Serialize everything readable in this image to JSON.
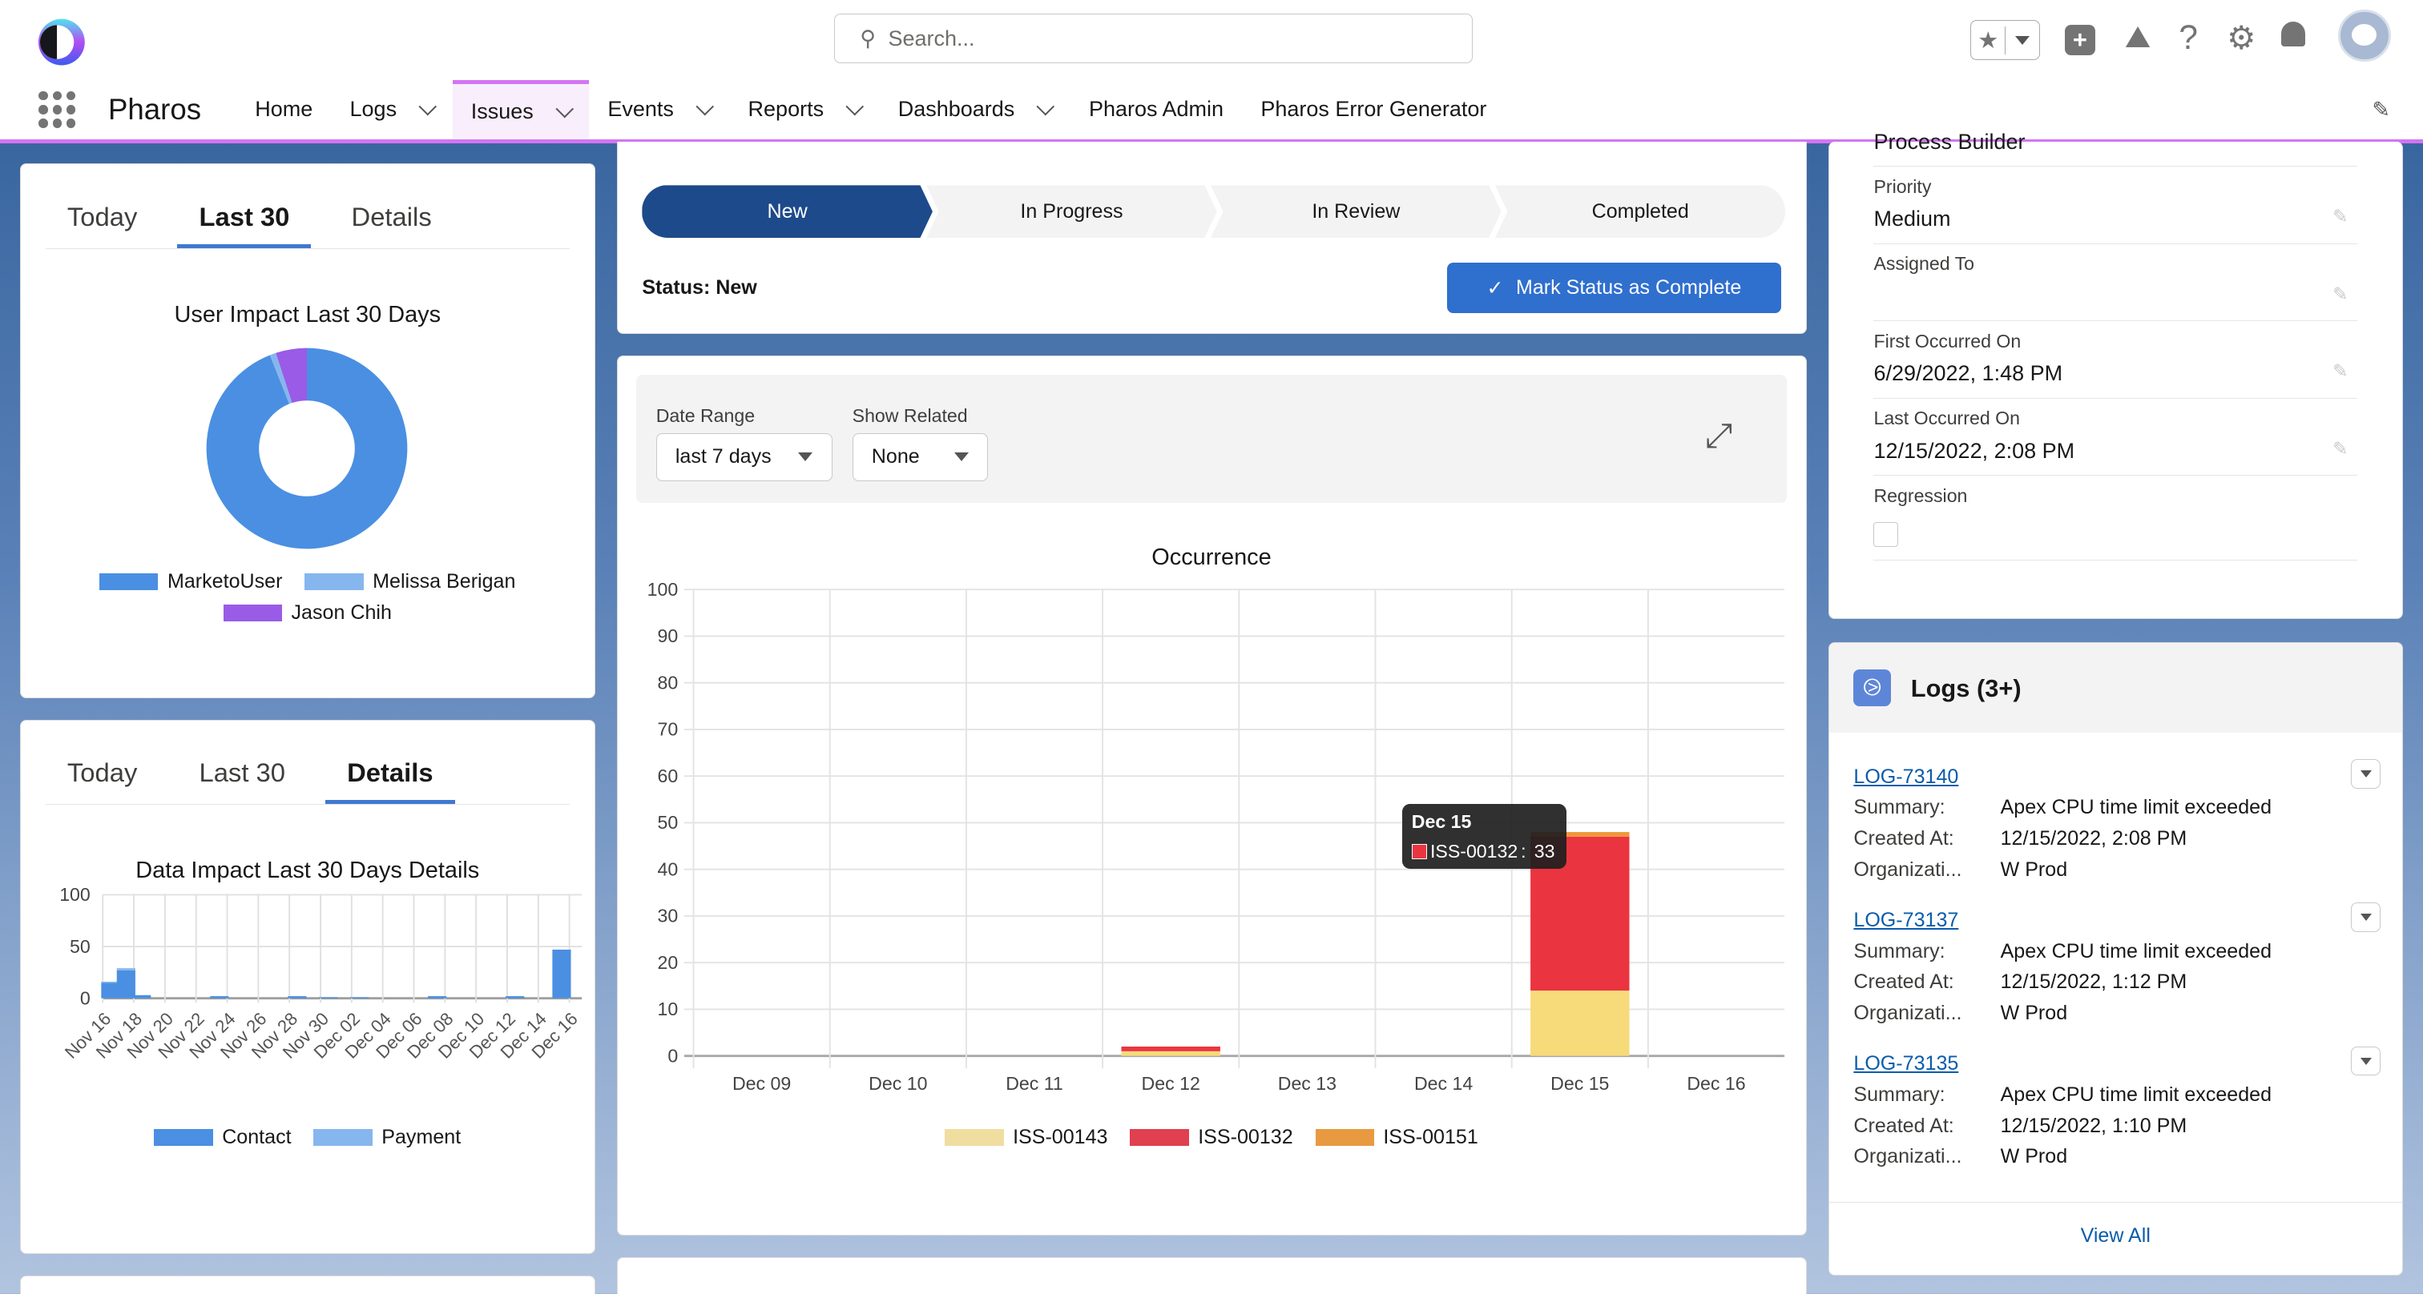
{
  "header": {
    "app_name": "Pharos",
    "search_placeholder": "Search...",
    "nav": [
      {
        "label": "Home",
        "dropdown": false
      },
      {
        "label": "Logs",
        "dropdown": true
      },
      {
        "label": "Issues",
        "dropdown": true,
        "active": true
      },
      {
        "label": "Events",
        "dropdown": true
      },
      {
        "label": "Reports",
        "dropdown": true
      },
      {
        "label": "Dashboards",
        "dropdown": true
      },
      {
        "label": "Pharos Admin",
        "dropdown": false
      },
      {
        "label": "Pharos Error Generator",
        "dropdown": false
      }
    ],
    "icons": [
      "favorites-star-icon",
      "add-icon",
      "trailhead-icon",
      "help-icon",
      "setup-gear-icon",
      "notifications-bell-icon",
      "avatar"
    ],
    "accent": "#d375f2"
  },
  "user_impact": {
    "tabs": [
      "Today",
      "Last 30",
      "Details"
    ],
    "active_tab": 1,
    "chart_data": {
      "type": "pie",
      "title": "User Impact Last 30 Days",
      "donut": true,
      "series": [
        {
          "name": "MarketoUser",
          "value": 94,
          "color": "#4a8fe2"
        },
        {
          "name": "Melissa Berigan",
          "value": 1,
          "color": "#86b6ee"
        },
        {
          "name": "Jason Chih",
          "value": 5,
          "color": "#9a5be6"
        }
      ]
    }
  },
  "data_impact": {
    "tabs": [
      "Today",
      "Last 30",
      "Details"
    ],
    "active_tab": 2,
    "chart_data": {
      "type": "bar",
      "stacked": true,
      "title": "Data Impact Last 30 Days Details",
      "ylim": [
        0,
        100
      ],
      "yticks": [
        0,
        50,
        100
      ],
      "xticks": [
        "Nov 16",
        "Nov 18",
        "Nov 20",
        "Nov 22",
        "Nov 24",
        "Nov 26",
        "Nov 28",
        "Nov 30",
        "Dec 02",
        "Dec 04",
        "Dec 06",
        "Dec 08",
        "Dec 10",
        "Dec 12",
        "Dec 14",
        "Dec 16"
      ],
      "categories": [
        "Nov 16",
        "Nov 17",
        "Nov 18",
        "Nov 23",
        "Nov 28",
        "Nov 30",
        "Dec 02",
        "Dec 07",
        "Dec 12",
        "Dec 15"
      ],
      "series": [
        {
          "name": "Contact",
          "color": "#4a8fe2",
          "values": [
            15,
            27,
            3,
            2,
            2,
            1,
            1,
            2,
            2,
            47
          ]
        },
        {
          "name": "Payment",
          "color": "#86b6ee",
          "values": [
            1,
            2,
            0,
            0,
            0,
            0,
            0,
            0,
            0,
            0
          ]
        }
      ],
      "legend": "bottom"
    }
  },
  "status_path": {
    "steps": [
      "New",
      "In Progress",
      "In Review",
      "Completed"
    ],
    "current": 0,
    "status_label": "Status: New",
    "mark_complete": "Mark Status as Complete"
  },
  "occurrence": {
    "filters": {
      "date_range_label": "Date Range",
      "date_range_value": "last 7 days",
      "show_related_label": "Show Related",
      "show_related_value": "None"
    },
    "chart_data": {
      "type": "bar",
      "stacked": true,
      "title": "Occurrence",
      "ylim": [
        0,
        100
      ],
      "yticks": [
        0,
        10,
        20,
        30,
        40,
        50,
        60,
        70,
        80,
        90,
        100
      ],
      "grid": true,
      "categories": [
        "Dec 09",
        "Dec 10",
        "Dec 11",
        "Dec 12",
        "Dec 13",
        "Dec 14",
        "Dec 15",
        "Dec 16"
      ],
      "series": [
        {
          "name": "ISS-00143",
          "color": "#f7da7a",
          "legend_color": "#f0dda0",
          "values": [
            0,
            0,
            0,
            1,
            0,
            0,
            14,
            0
          ]
        },
        {
          "name": "ISS-00132",
          "color": "#ea3540",
          "legend_color": "#e0404f",
          "values": [
            0,
            0,
            0,
            1,
            0,
            0,
            33,
            0
          ]
        },
        {
          "name": "ISS-00151",
          "color": "#ee973a",
          "legend_color": "#e89a40",
          "values": [
            0,
            0,
            0,
            0,
            0,
            0,
            1,
            0
          ]
        }
      ],
      "legend": "bottom",
      "tooltip": {
        "title": "Dec 15",
        "series": "ISS-00132",
        "value": "33"
      }
    }
  },
  "details": {
    "partial_value": "Process Builder",
    "fields": [
      {
        "label": "Priority",
        "value": "Medium"
      },
      {
        "label": "Assigned To",
        "value": ""
      },
      {
        "label": "First Occurred On",
        "value": "6/29/2022, 1:48 PM"
      },
      {
        "label": "Last Occurred On",
        "value": "12/15/2022, 2:08 PM"
      }
    ],
    "regression_label": "Regression",
    "regression_checked": false
  },
  "logs": {
    "title": "Logs (3+)",
    "labels": {
      "summary": "Summary:",
      "created": "Created At:",
      "org": "Organizati..."
    },
    "items": [
      {
        "id": "LOG-73140",
        "summary": "Apex CPU time limit exceeded",
        "created": "12/15/2022, 2:08 PM",
        "org": "W Prod"
      },
      {
        "id": "LOG-73137",
        "summary": "Apex CPU time limit exceeded",
        "created": "12/15/2022, 1:12 PM",
        "org": "W Prod"
      },
      {
        "id": "LOG-73135",
        "summary": "Apex CPU time limit exceeded",
        "created": "12/15/2022, 1:10 PM",
        "org": "W Prod"
      }
    ],
    "view_all": "View All"
  }
}
